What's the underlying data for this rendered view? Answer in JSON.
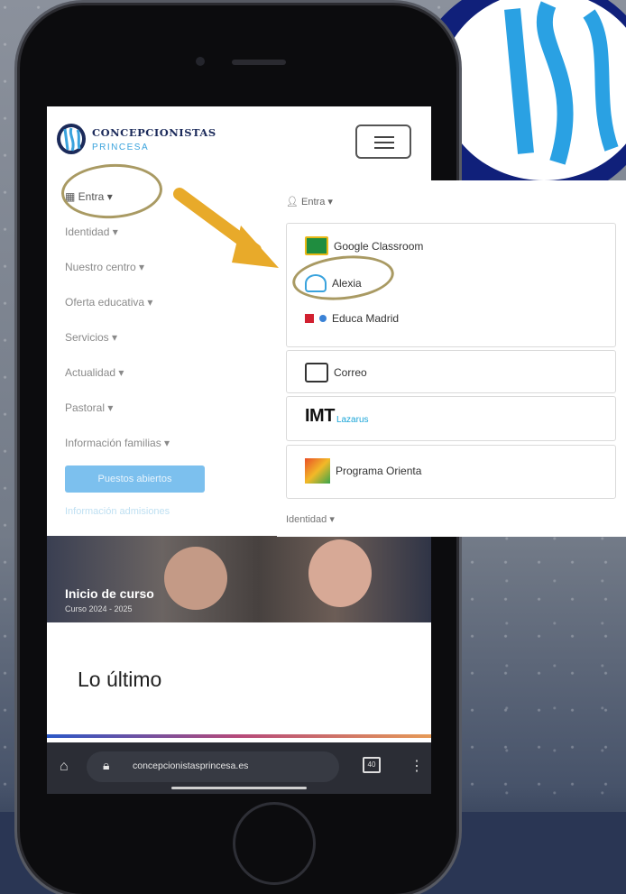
{
  "site": {
    "logo_name": "CONCEPCIONISTAS",
    "logo_sub": "PRINCESA",
    "nav": {
      "entra": "Entra",
      "items": [
        "Identidad",
        "Nuestro centro",
        "Oferta educativa",
        "Servicios",
        "Actualidad",
        "Pastoral",
        "Información familias"
      ],
      "cta": "Puestos abiertos",
      "last": "Información admisiones"
    },
    "banner": {
      "title": "Inicio de curso",
      "subtitle": "Curso 2024 - 2025"
    },
    "latest_heading": "Lo último"
  },
  "browser": {
    "url": "concepcionistasprincesa.es",
    "tabs_count": "40"
  },
  "dropdown": {
    "entra": "Entra",
    "items": {
      "classroom": "Google Classroom",
      "alexia": "Alexia",
      "educa": "Educa Madrid",
      "correo": "Correo",
      "imt_main": "IMT",
      "imt_sub": "Lazarus",
      "orienta": "Programa Orienta"
    },
    "identidad": "Identidad"
  },
  "colors": {
    "accent_blue": "#3aa3dd",
    "navy": "#1b2a5a",
    "highlight_circle": "#a99a63",
    "arrow": "#e8aa2a"
  }
}
